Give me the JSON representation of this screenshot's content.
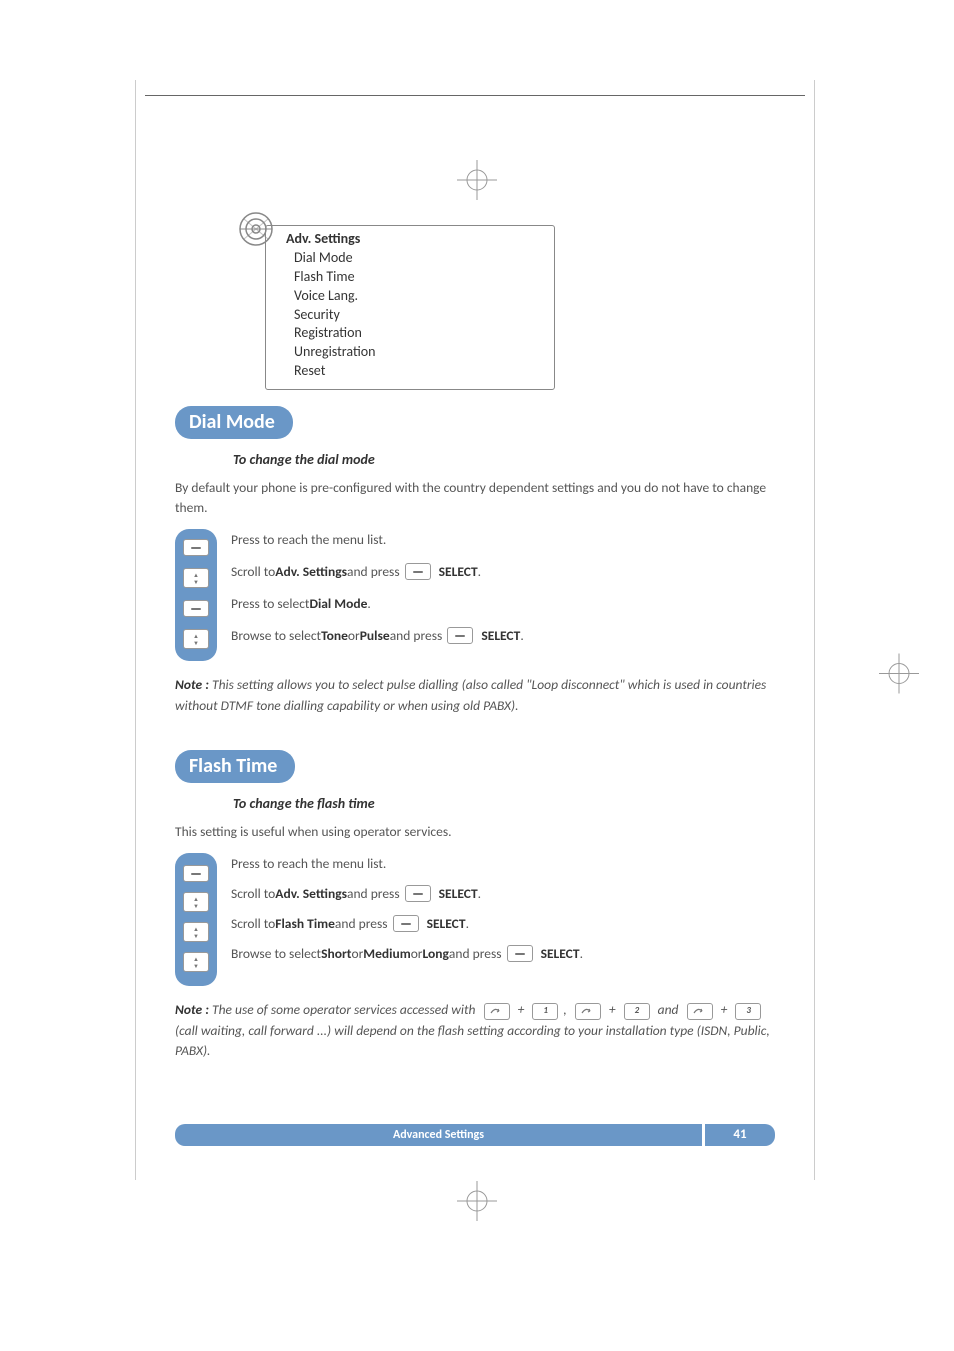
{
  "menu": {
    "title": "Adv. Settings",
    "items": [
      "Dial Mode",
      "Flash Time",
      "Voice Lang.",
      "Security",
      "Registration",
      "Unregistration",
      "Reset"
    ]
  },
  "section1": {
    "title": "Dial Mode",
    "subhead": "To change the dial mode",
    "intro": "By default your phone is pre-configured with the country dependent settings and you do not have to change them.",
    "steps": {
      "s1": "Press to reach the menu list.",
      "s2a": "Scroll to ",
      "s2b": "Adv. Settings",
      "s2c": " and press ",
      "s2d": "SELECT",
      "s2e": ".",
      "s3a": "Press to select ",
      "s3b": "Dial Mode",
      "s3c": ".",
      "s4a": "Browse to select ",
      "s4b": "Tone",
      "s4c": " or ",
      "s4d": "Pulse",
      "s4e": " and press ",
      "s4f": "SELECT",
      "s4g": "."
    },
    "note_label": "Note :",
    "note": " This setting allows you to select pulse dialling (also called \"Loop disconnect\" which is used in countries without DTMF tone dialling capability or when using old PABX)."
  },
  "section2": {
    "title": "Flash Time",
    "subhead": "To change the flash time",
    "intro": "This setting is useful when using operator services.",
    "steps": {
      "s1": "Press to reach the menu list.",
      "s2a": "Scroll to ",
      "s2b": "Adv. Settings",
      "s2c": " and press ",
      "s2d": "SELECT",
      "s2e": ".",
      "s3a": "Scroll to ",
      "s3b": "Flash Time",
      "s3c": " and press ",
      "s3d": "SELECT",
      "s3e": ".",
      "s4a": "Browse to select ",
      "s4b": "Short",
      "s4c": " or ",
      "s4d": "Medium",
      "s4e": " or ",
      "s4f": "Long",
      "s4g": " and press ",
      "s4h": "SELECT",
      "s4i": "."
    },
    "note_label": "Note :",
    "note_a": " The use of some operator services accessed with ",
    "note_plus": " + ",
    "note_comma": ", ",
    "note_and": " and ",
    "key1": "1",
    "key2": "2",
    "key3": "3",
    "note_b": " (call waiting, call forward ...) will depend on the flash setting according to your installation type (ISDN, Public, PABX)."
  },
  "footer": {
    "label": "Advanced Settings",
    "page": "41"
  }
}
